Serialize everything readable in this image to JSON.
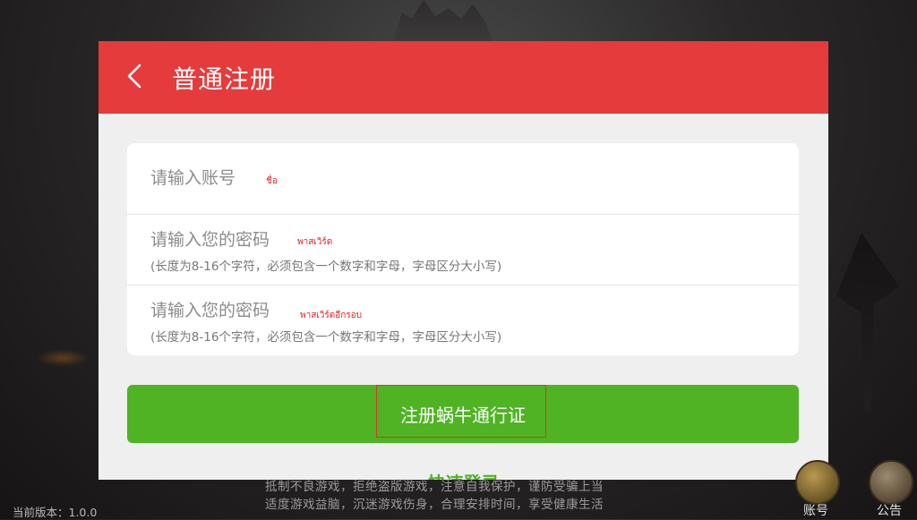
{
  "header": {
    "back_icon": "chevron-left-icon",
    "title": "普通注册"
  },
  "form": {
    "account": {
      "placeholder": "请输入账号",
      "annotation": "ชื่อ"
    },
    "password": {
      "placeholder": "请输入您的密码",
      "hint": "(长度为8-16个字符，必须包含一个数字和字母，字母区分大小写)",
      "annotation": "พาสเวิร์ด"
    },
    "confirm_password": {
      "placeholder": "请输入您的密码",
      "hint": "(长度为8-16个字符，必须包含一个数字和字母，字母区分大小写)",
      "annotation": "พาสเวิร์ดอีกรอบ"
    },
    "submit_label": "注册蜗牛通行证",
    "quick_login_label": "快速登录"
  },
  "footer": {
    "notice_line1": "抵制不良游戏，拒绝盗版游戏，注意自我保护，谨防受骗上当",
    "notice_line2": "适度游戏益脑，沉迷游戏伤身，合理安排时间，享受健康生活",
    "version": "当前版本：1.0.0",
    "account_label": "账号",
    "notice_label": "公告"
  },
  "colors": {
    "header": "#e63b3c",
    "primary_button": "#4fb324",
    "annotation": "#e02020"
  }
}
